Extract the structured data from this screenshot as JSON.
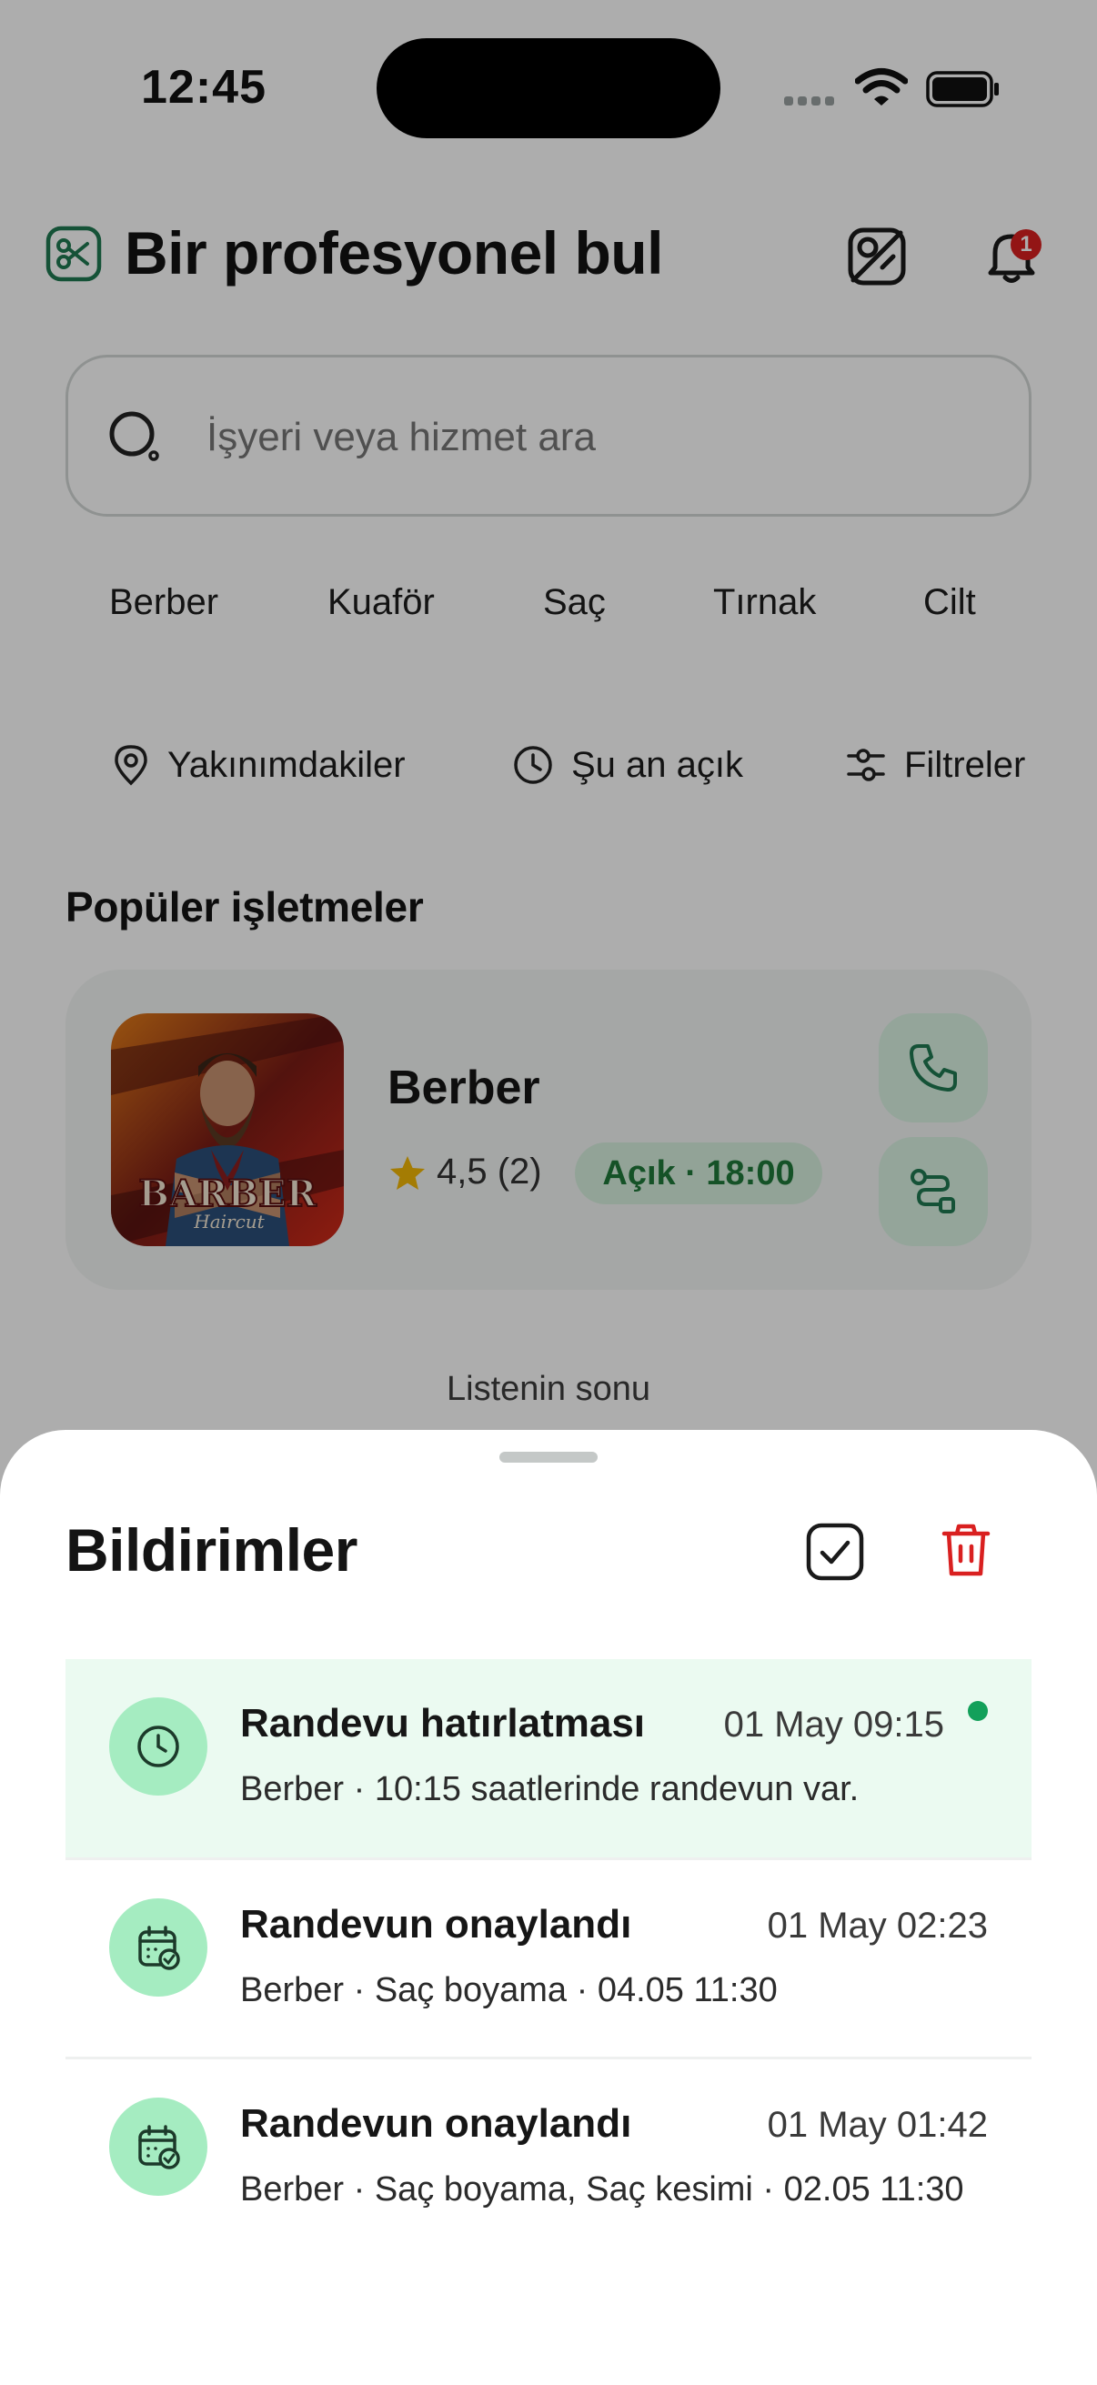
{
  "status_bar": {
    "time": "12:45"
  },
  "header": {
    "title": "Bir profesyonel bul",
    "notification_count": "1"
  },
  "search": {
    "placeholder": "İşyeri veya hizmet ara"
  },
  "categories": [
    "Berber",
    "Kuaför",
    "Saç",
    "Tırnak",
    "Cilt"
  ],
  "filters": {
    "nearby": "Yakınımdakiler",
    "open_now": "Şu an açık",
    "filters": "Filtreler"
  },
  "popular": {
    "title": "Popüler işletmeler",
    "business": {
      "name": "Berber",
      "rating": "4,5 (2)",
      "status": "Açık · 18:00",
      "logo_text": "BARBER",
      "logo_subtext": "Haircut"
    }
  },
  "list_end": "Listenin sonu",
  "notifications_sheet": {
    "title": "Bildirimler",
    "items": [
      {
        "title": "Randevu hatırlatması",
        "time": "01 May 09:15",
        "body": "Berber · 10:15 saatlerinde randevun var.",
        "icon": "clock-icon",
        "unread": true
      },
      {
        "title": "Randevun onaylandı",
        "time": "01 May 02:23",
        "body": "Berber · Saç boyama · 04.05 11:30",
        "icon": "calendar-check-icon",
        "unread": false
      },
      {
        "title": "Randevun onaylandı",
        "time": "01 May 01:42",
        "body": "Berber · Saç boyama, Saç kesimi · 02.05 11:30",
        "icon": "calendar-check-icon",
        "unread": false
      }
    ]
  },
  "colors": {
    "accent": "#1f7a52",
    "open_badge_bg": "#d8f1df",
    "notification_icon_bg": "#a5ecc1",
    "unread_row_bg": "#ebfaf1",
    "danger": "#d92020"
  }
}
